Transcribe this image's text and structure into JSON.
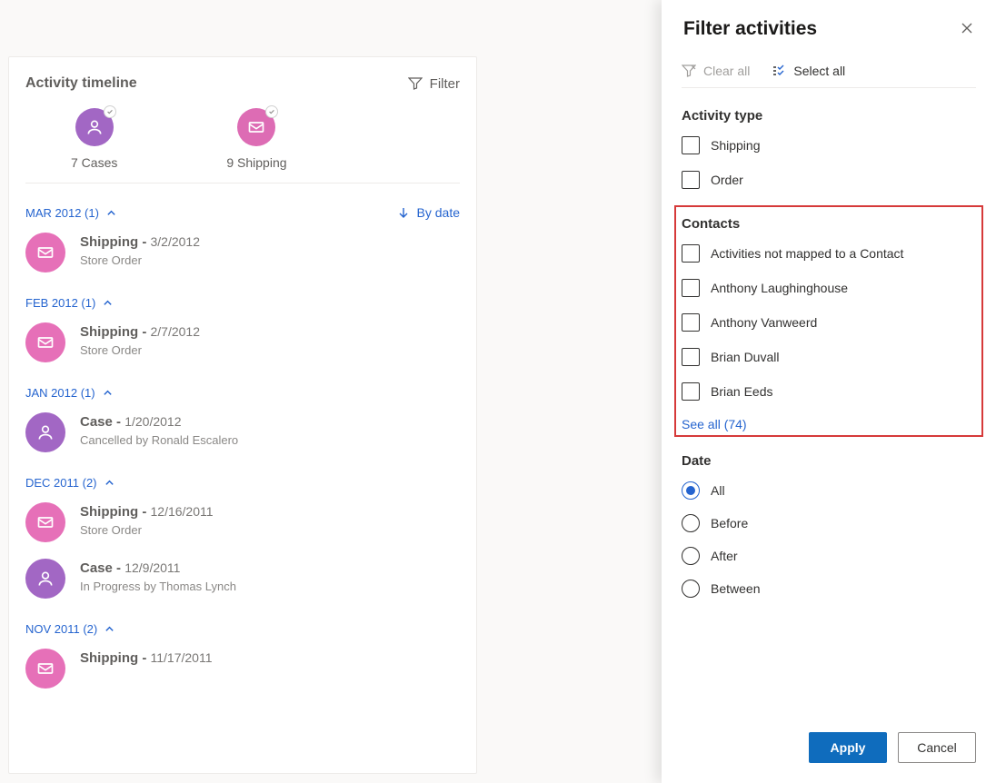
{
  "timeline": {
    "title": "Activity timeline",
    "filter_label": "Filter",
    "summary": {
      "cases": {
        "label": "7 Cases"
      },
      "shipping": {
        "label": "9 Shipping"
      }
    },
    "sort_by_label": "By date",
    "groups": [
      {
        "header": "MAR 2012 (1)",
        "items": [
          {
            "type": "shipping",
            "title": "Shipping",
            "date": "3/2/2012",
            "sub": "Store Order"
          }
        ]
      },
      {
        "header": "FEB 2012 (1)",
        "items": [
          {
            "type": "shipping",
            "title": "Shipping",
            "date": "2/7/2012",
            "sub": "Store Order"
          }
        ]
      },
      {
        "header": "JAN 2012 (1)",
        "items": [
          {
            "type": "case",
            "title": "Case",
            "date": "1/20/2012",
            "sub": "Cancelled by Ronald Escalero"
          }
        ]
      },
      {
        "header": "DEC 2011 (2)",
        "items": [
          {
            "type": "shipping",
            "title": "Shipping",
            "date": "12/16/2011",
            "sub": "Store Order"
          },
          {
            "type": "case",
            "title": "Case",
            "date": "12/9/2011",
            "sub": "In Progress by Thomas Lynch"
          }
        ]
      },
      {
        "header": "NOV 2011 (2)",
        "items": [
          {
            "type": "shipping",
            "title": "Shipping",
            "date": "11/17/2011",
            "sub": ""
          }
        ]
      }
    ]
  },
  "panel": {
    "title": "Filter activities",
    "clear_all": "Clear all",
    "select_all": "Select all",
    "activity_type_title": "Activity type",
    "activity_types": [
      "Shipping",
      "Order"
    ],
    "contacts_title": "Contacts",
    "contacts": [
      "Activities not mapped to a Contact",
      "Anthony Laughinghouse",
      "Anthony Vanweerd",
      "Brian Duvall",
      "Brian Eeds"
    ],
    "see_all": "See all (74)",
    "date_title": "Date",
    "date_options": [
      "All",
      "Before",
      "After",
      "Between"
    ],
    "date_selected": "All",
    "apply": "Apply",
    "cancel": "Cancel"
  }
}
